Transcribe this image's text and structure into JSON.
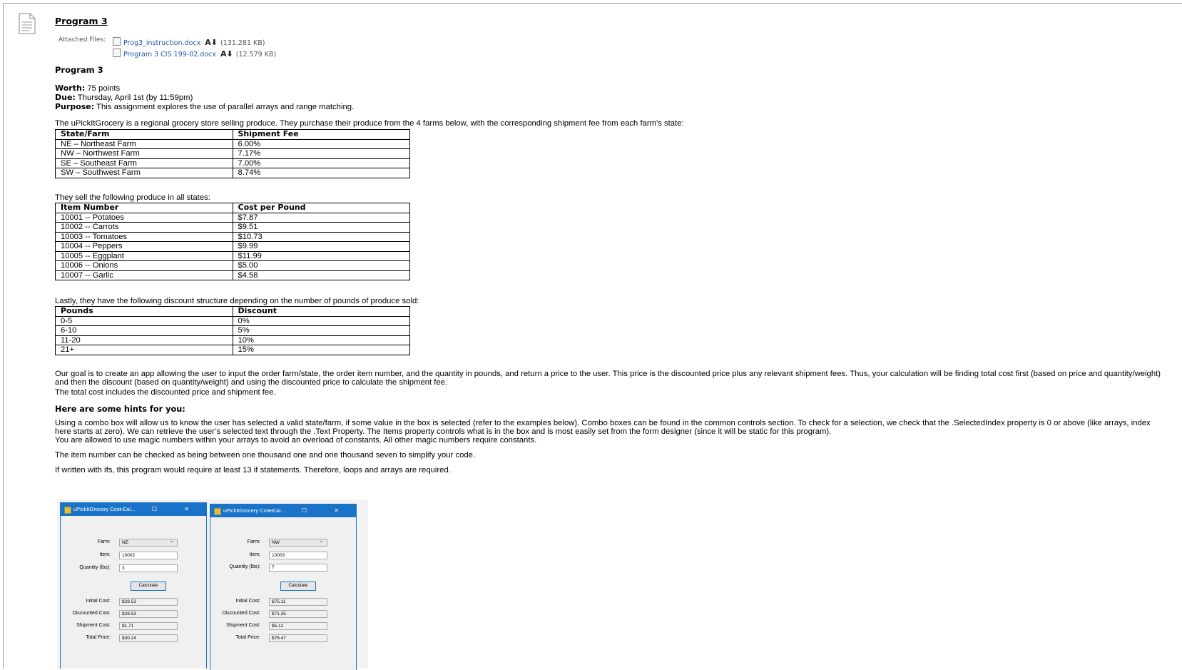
{
  "assignment": {
    "title": "Program 3",
    "attached_label": "Attached Files:",
    "files": [
      {
        "name": "Prog3_instruction.docx",
        "size": "(131.281 KB)"
      },
      {
        "name": "Program 3 CIS 199-02.docx",
        "size": "(12.579 KB)"
      }
    ],
    "download_icon": "download-icon",
    "heading": "Program 3",
    "worth_label": "Worth:",
    "worth": " 75 points",
    "due_label": "Due:",
    "due": " Thursday, April 1st (by 11:59pm)",
    "purpose_label": "Purpose:",
    "purpose": " This assignment explores the use of parallel arrays and range matching.",
    "intro": "The uPickItGrocery is a regional grocery store selling produce. They purchase their produce from the 4 farms below, with the corresponding shipment fee from each farm's state:",
    "farms_table": {
      "headers": [
        "State/Farm",
        "Shipment Fee"
      ],
      "rows": [
        [
          "NE – Northeast Farm",
          "6.00%"
        ],
        [
          "NW – Northwest Farm",
          "7.17%"
        ],
        [
          "SE – Southeast Farm",
          "7.00%"
        ],
        [
          "SW – Southwest Farm",
          "8.74%"
        ]
      ]
    },
    "produce_intro": "They sell the following produce in all states:",
    "produce_table": {
      "headers": [
        "Item Number",
        "Cost per Pound"
      ],
      "rows": [
        [
          "10001 -- Potatoes",
          "$7.87"
        ],
        [
          "10002 -- Carrots",
          "$9.51"
        ],
        [
          "10003 -- Tomatoes",
          "$10.73"
        ],
        [
          "10004 -- Peppers",
          "$9.99"
        ],
        [
          "10005 -- Eggplant",
          "$11.99"
        ],
        [
          "10006 -- Onions",
          "$5.00"
        ],
        [
          "10007 -- Garlic",
          "$4.58"
        ]
      ]
    },
    "discount_intro": "Lastly, they have the following discount structure depending on the number of pounds of produce sold:",
    "discount_table": {
      "headers": [
        "Pounds",
        "Discount"
      ],
      "rows": [
        [
          "0-5",
          "0%"
        ],
        [
          "6-10",
          "5%"
        ],
        [
          "11-20",
          "10%"
        ],
        [
          "21+",
          "15%"
        ]
      ]
    },
    "goal": "Our goal is to create an app allowing the user to input the order farm/state, the order item number, and the quantity in pounds, and return a price to the user. This price is the discounted price plus any relevant shipment fees. Thus, your calculation will be finding total cost first (based on price and quantity/weight) and then the discount (based on quantity/weight) and using the discounted price to calculate the shipment fee.",
    "goal2": "The total cost includes the discounted price and shipment fee.",
    "hints_heading": "Here are some hints for you:",
    "hint1": "Using a combo box will allow us to know the user has selected a valid state/farm, if some value in the box is selected (refer to the examples below). Combo boxes can be found in the common controls section. To check for a selection, we check that the .SelectedIndex property is 0 or above (like arrays, index here starts at zero). We can retrieve the user’s selected text through the .Text Property. The Items property controls what is in the box and is most easily set from the form designer (since it will be static for this program).",
    "hint1b": "You are allowed to use magic numbers within your arrays to avoid an overload of constants. All other magic numbers require constants.",
    "hint2": "The item number can be checked as being between one thousand one and one thousand seven to simplify your code.",
    "hint3": "If written with ifs, this program would require at least 13 if statements. Therefore, loops and arrays are required."
  },
  "example_windows": [
    {
      "title": "uPickItGrocery Cost Cal...",
      "controls": "—   ☐   ✕",
      "farm_label": "Farm:",
      "farm": "NE",
      "item_label": "Item:",
      "item": "10002",
      "qty_label": "Quantity (lbs):",
      "qty": "3",
      "button": "Calculate",
      "initial_label": "Initial Cost:",
      "initial": "$28.53",
      "discounted_label": "Discounted Cost:",
      "discounted": "$28.53",
      "shipment_label": "Shipment Cost:",
      "shipment": "$1.71",
      "total_label": "Total Price:",
      "total": "$30.24"
    },
    {
      "title": "uPickItGrocery Cost Cal...",
      "controls": "—   ☐   ✕",
      "farm_label": "Farm:",
      "farm": "NW",
      "item_label": "Item:",
      "item": "10003",
      "qty_label": "Quantity (lbs):",
      "qty": "7",
      "button": "Calculate",
      "initial_label": "Initial Cost:",
      "initial": "$75.11",
      "discounted_label": "Discounted Cost:",
      "discounted": "$71.35",
      "shipment_label": "Shipment Cost:",
      "shipment": "$5.12",
      "total_label": "Total Price:",
      "total": "$76.47"
    }
  ]
}
